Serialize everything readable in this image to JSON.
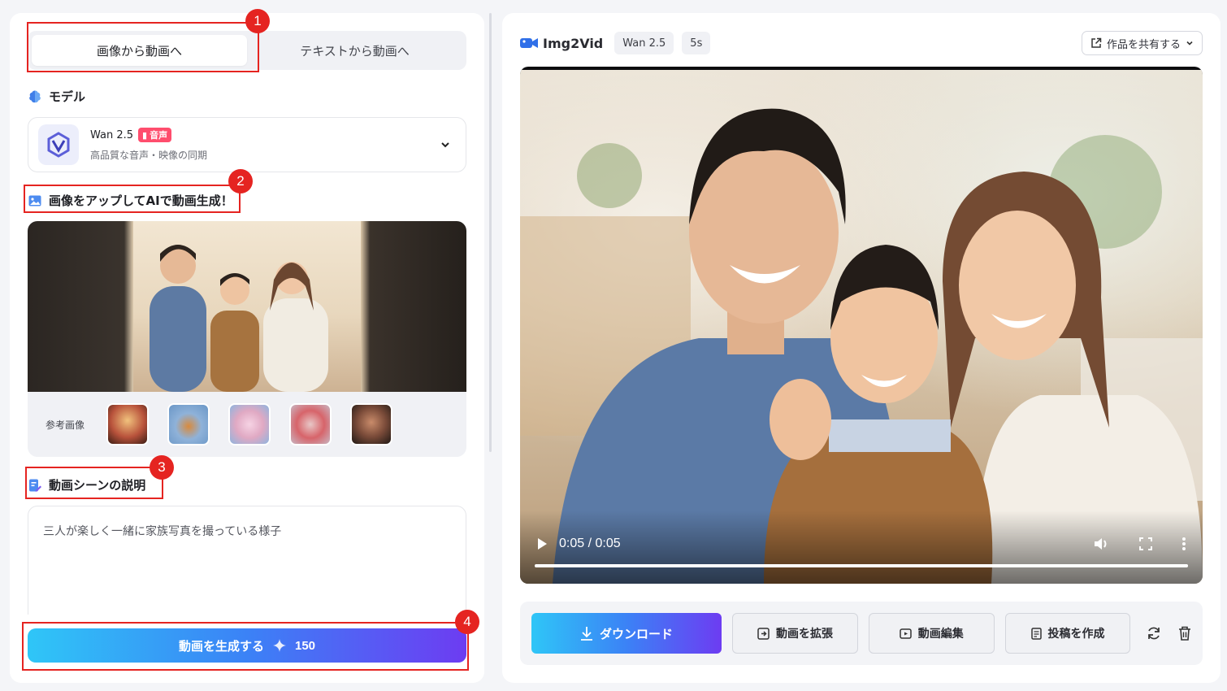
{
  "mode_tabs": [
    {
      "label": "画像から動画へ",
      "active": true
    },
    {
      "label": "テキストから動画へ",
      "active": false
    }
  ],
  "model_section": {
    "label": "モデル",
    "model_name": "Wan 2.5",
    "badge": "音声",
    "description": "高品質な音声・映像の同期",
    "icon": "model-brain-icon"
  },
  "upload_section": {
    "label": "画像をアップしてAIで動画生成！",
    "reference_label": "参考画像",
    "reference_thumbnails": [
      {
        "name": "ref-woman-fire",
        "color": "#b8523b"
      },
      {
        "name": "ref-cat-mountain",
        "color": "#6a96c6"
      },
      {
        "name": "ref-pink-character",
        "color": "#e0a9c3"
      },
      {
        "name": "ref-red-dragon",
        "color": "#d7646a"
      },
      {
        "name": "ref-boxer",
        "color": "#7a4b39"
      }
    ]
  },
  "prompt_section": {
    "label": "動画シーンの説明",
    "value": "三人が楽しく一緒に家族写真を撮っている様子"
  },
  "generate": {
    "label": "動画を生成する",
    "cost": "150"
  },
  "preview": {
    "app_name": "Img2Vid",
    "model_chip": "Wan 2.5",
    "duration_chip": "5s",
    "share_label": "作品を共有する",
    "time_display": "0:05 / 0:05",
    "progress": 1.0
  },
  "actions": {
    "download": "ダウンロード",
    "extend": "動画を拡張",
    "edit": "動画編集",
    "post": "投稿を作成"
  },
  "annotations": [
    "1",
    "2",
    "3",
    "4"
  ],
  "colors": {
    "accent_gradient_start": "#2fc6f7",
    "accent_gradient_end": "#6d3cf2",
    "annotation_red": "#e52421"
  }
}
